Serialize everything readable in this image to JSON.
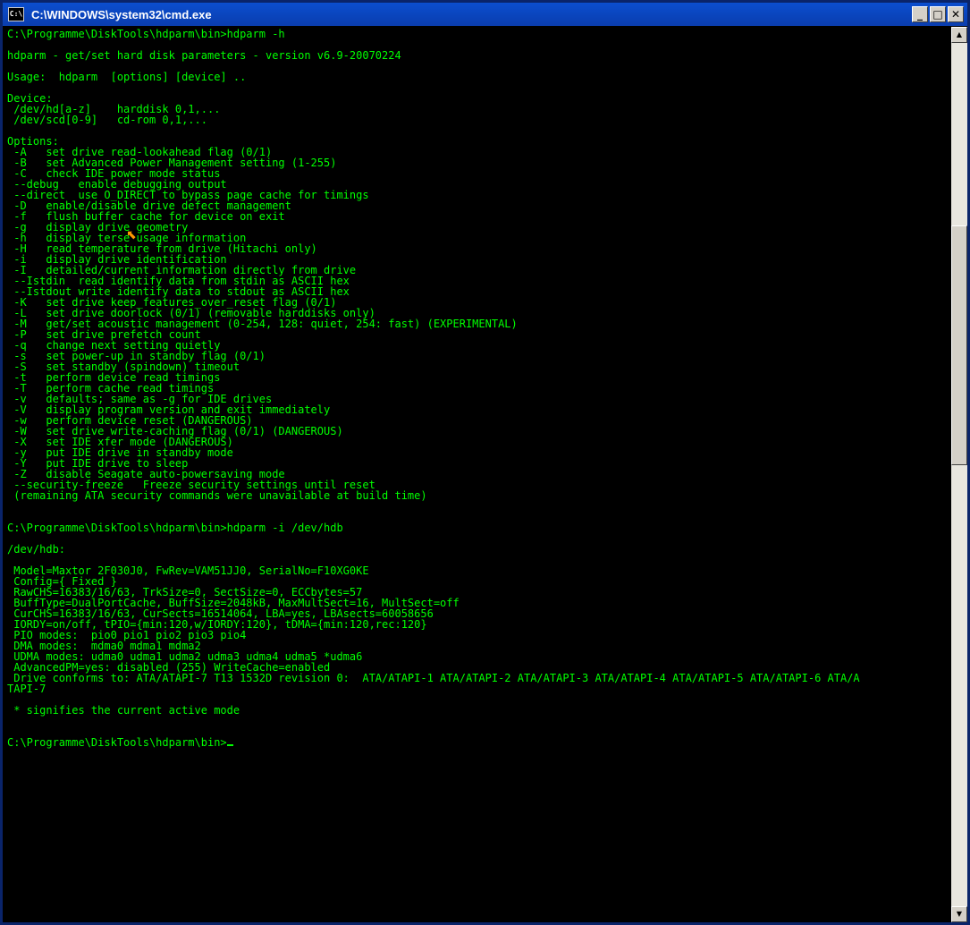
{
  "window": {
    "title": "C:\\WINDOWS\\system32\\cmd.exe",
    "icon": "cmd-icon",
    "icon_text": "C:\\",
    "minimize_label": "_",
    "maximize_label": "□",
    "close_label": "✕"
  },
  "console": {
    "lines": [
      "C:\\Programme\\DiskTools\\hdparm\\bin>hdparm -h",
      "",
      "hdparm - get/set hard disk parameters - version v6.9-20070224",
      "",
      "Usage:  hdparm  [options] [device] ..",
      "",
      "Device:",
      " /dev/hd[a-z]    harddisk 0,1,...",
      " /dev/scd[0-9]   cd-rom 0,1,...",
      "",
      "Options:",
      " -A   set drive read-lookahead flag (0/1)",
      " -B   set Advanced Power Management setting (1-255)",
      " -C   check IDE power mode status",
      " --debug   enable debugging output",
      " --direct  use O_DIRECT to bypass page cache for timings",
      " -D   enable/disable drive defect management",
      " -f   flush buffer cache for device on exit",
      " -g   display drive geometry",
      " -h   display terse usage information",
      " -H   read temperature from drive (Hitachi only)",
      " -i   display drive identification",
      " -I   detailed/current information directly from drive",
      " --Istdin  read identify data from stdin as ASCII hex",
      " --Istdout write identify data to stdout as ASCII hex",
      " -K   set drive keep_features_over_reset flag (0/1)",
      " -L   set drive doorlock (0/1) (removable harddisks only)",
      " -M   get/set acoustic management (0-254, 128: quiet, 254: fast) (EXPERIMENTAL)",
      " -P   set drive prefetch count",
      " -q   change next setting quietly",
      " -s   set power-up in standby flag (0/1)",
      " -S   set standby (spindown) timeout",
      " -t   perform device read timings",
      " -T   perform cache read timings",
      " -v   defaults; same as -g for IDE drives",
      " -V   display program version and exit immediately",
      " -w   perform device reset (DANGEROUS)",
      " -W   set drive write-caching flag (0/1) (DANGEROUS)",
      " -X   set IDE xfer mode (DANGEROUS)",
      " -y   put IDE drive in standby mode",
      " -Y   put IDE drive to sleep",
      " -Z   disable Seagate auto-powersaving mode",
      " --security-freeze   Freeze security settings until reset",
      " (remaining ATA security commands were unavailable at build time)",
      "",
      "",
      "C:\\Programme\\DiskTools\\hdparm\\bin>hdparm -i /dev/hdb",
      "",
      "/dev/hdb:",
      "",
      " Model=Maxtor 2F030J0, FwRev=VAM51JJ0, SerialNo=F10XG0KE",
      " Config={ Fixed }",
      " RawCHS=16383/16/63, TrkSize=0, SectSize=0, ECCbytes=57",
      " BuffType=DualPortCache, BuffSize=2048kB, MaxMultSect=16, MultSect=off",
      " CurCHS=16383/16/63, CurSects=16514064, LBA=yes, LBAsects=60058656",
      " IORDY=on/off, tPIO={min:120,w/IORDY:120}, tDMA={min:120,rec:120}",
      " PIO modes:  pio0 pio1 pio2 pio3 pio4",
      " DMA modes:  mdma0 mdma1 mdma2",
      " UDMA modes: udma0 udma1 udma2 udma3 udma4 udma5 *udma6",
      " AdvancedPM=yes: disabled (255) WriteCache=enabled",
      " Drive conforms to: ATA/ATAPI-7 T13 1532D revision 0:  ATA/ATAPI-1 ATA/ATAPI-2 ATA/ATAPI-3 ATA/ATAPI-4 ATA/ATAPI-5 ATA/ATAPI-6 ATA/A",
      "TAPI-7",
      "",
      " * signifies the current active mode",
      "",
      "",
      "C:\\Programme\\DiskTools\\hdparm\\bin>"
    ]
  },
  "scrollbar": {
    "up_arrow": "▲",
    "down_arrow": "▼",
    "position_fraction": 0.22
  },
  "colors": {
    "console_text": "#00ff00",
    "console_bg": "#000000",
    "titlebar": "#0a3dae"
  }
}
